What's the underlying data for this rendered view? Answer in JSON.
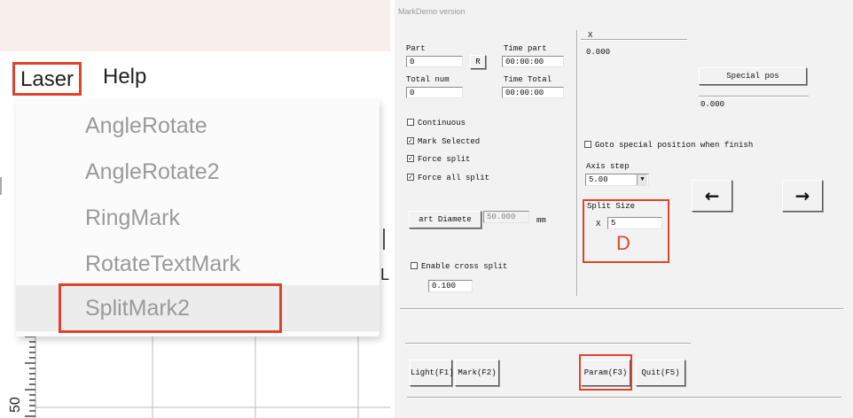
{
  "menu": {
    "bar": [
      "Laser",
      "Help"
    ],
    "items": [
      "AngleRotate",
      "AngleRotate2",
      "RingMark",
      "RotateTextMark",
      "SplitMark2"
    ],
    "selected_item": "SplitMark2"
  },
  "ruler": {
    "label": "50"
  },
  "edge_letter": "L",
  "dialog": {
    "title": "MarkDemo version",
    "part": {
      "label": "Part",
      "value": "0",
      "reset_button": "R"
    },
    "time_part": {
      "label": "Time part",
      "value": "00:00:00"
    },
    "total_num": {
      "label": "Total num",
      "value": "0"
    },
    "time_total": {
      "label": "Time Total",
      "value": "00:00:00"
    },
    "checks": [
      {
        "label": "Continuous",
        "checked": false
      },
      {
        "label": "Mark Selected",
        "checked": true
      },
      {
        "label": "Force split",
        "checked": true
      },
      {
        "label": "Force all split",
        "checked": true
      }
    ],
    "part_diameter": {
      "button": "art Diamete",
      "value": "50.000",
      "unit": "mm"
    },
    "enable_cross_split": {
      "label": "Enable cross split",
      "checked": false,
      "value": "0.100"
    },
    "x": {
      "label": "X",
      "value": "0.000"
    },
    "special_pos": {
      "button": "Special pos",
      "value": "0.000"
    },
    "goto_special": {
      "label": "Goto special position when finish",
      "checked": false
    },
    "axis_step": {
      "label": "Axis step",
      "value": "5.00"
    },
    "split_size": {
      "label": "Split Size",
      "x_label": "X",
      "value": "5",
      "annotation": "D"
    },
    "arrows": {
      "left": "←",
      "right": "→"
    },
    "buttons": [
      "Light(F1)",
      "Mark(F2)",
      "Param(F3)",
      "Quit(F5)"
    ]
  },
  "colors": {
    "highlight": "#e0432d"
  }
}
